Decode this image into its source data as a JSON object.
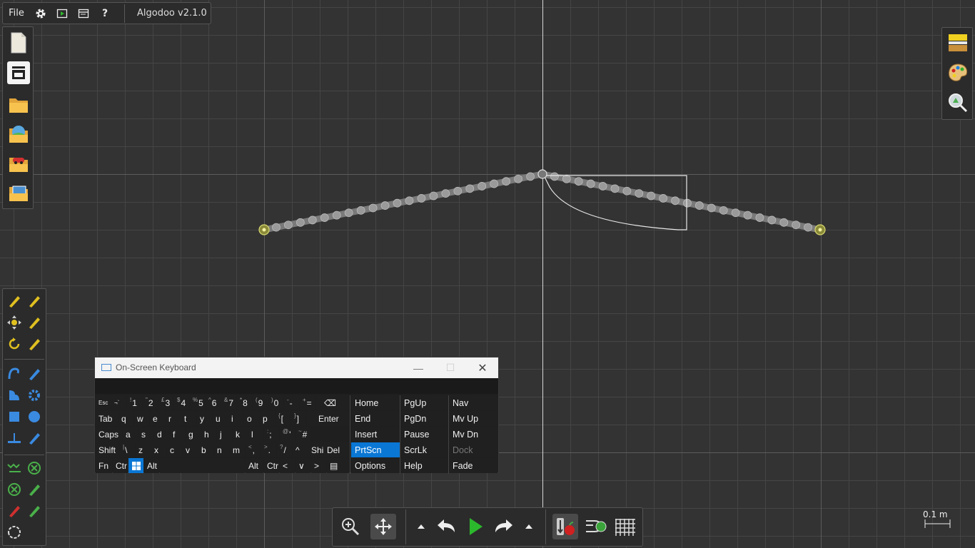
{
  "app": {
    "title": "Algodoo v2.1.0",
    "menu_file": "File"
  },
  "colors": {
    "background": "#333333",
    "grid_minor": "#444444",
    "grid_major": "#5a5a5a",
    "axis": "#d8d8d8",
    "accent_green": "#2cb82c",
    "osk_selected": "#0a77d5"
  },
  "top_icons": [
    "gear-icon",
    "play-window-icon",
    "window-icon",
    "help-icon"
  ],
  "help_label": "?",
  "file_panel": [
    "new-scene-icon",
    "scene-panel-icon",
    "open-folder-icon",
    "landscape-folder-icon",
    "car-folder-icon",
    "photo-folder-icon"
  ],
  "right_panel": [
    "background-icon",
    "palette-icon",
    "zoom-search-icon"
  ],
  "scale": {
    "label": "0.1 m"
  },
  "osk": {
    "title": "On-Screen Keyboard",
    "rows": [
      [
        {
          "t": "Esc",
          "s": true
        },
        {
          "t": "¬`",
          "s": true
        },
        {
          "t": "1",
          "u": "!"
        },
        {
          "t": "2",
          "u": "\""
        },
        {
          "t": "3",
          "u": "£"
        },
        {
          "t": "4",
          "u": "$"
        },
        {
          "t": "5",
          "u": "%"
        },
        {
          "t": "6",
          "u": "^"
        },
        {
          "t": "7",
          "u": "&"
        },
        {
          "t": "8",
          "u": "*"
        },
        {
          "t": "9",
          "u": "("
        },
        {
          "t": "0",
          "u": ")"
        },
        {
          "t": "-",
          "u": "-"
        },
        {
          "t": "=",
          "u": "+"
        },
        {
          "t": "⌫"
        }
      ],
      [
        {
          "t": "Tab"
        },
        {
          "t": "q"
        },
        {
          "t": "w"
        },
        {
          "t": "e"
        },
        {
          "t": "r"
        },
        {
          "t": "t"
        },
        {
          "t": "y"
        },
        {
          "t": "u"
        },
        {
          "t": "i"
        },
        {
          "t": "o"
        },
        {
          "t": "p"
        },
        {
          "t": "[",
          "u": "{"
        },
        {
          "t": "]",
          "u": "}"
        },
        {
          "t": "Enter"
        }
      ],
      [
        {
          "t": "Caps"
        },
        {
          "t": "a"
        },
        {
          "t": "s"
        },
        {
          "t": "d"
        },
        {
          "t": "f"
        },
        {
          "t": "g"
        },
        {
          "t": "h"
        },
        {
          "t": "j"
        },
        {
          "t": "k"
        },
        {
          "t": "l"
        },
        {
          "t": ";",
          "u": ":"
        },
        {
          "t": "'",
          "u": "@"
        },
        {
          "t": "#",
          "u": "~"
        }
      ],
      [
        {
          "t": "Shift"
        },
        {
          "t": "\\",
          "u": "|"
        },
        {
          "t": "z"
        },
        {
          "t": "x"
        },
        {
          "t": "c"
        },
        {
          "t": "v"
        },
        {
          "t": "b"
        },
        {
          "t": "n"
        },
        {
          "t": "m"
        },
        {
          "t": ",",
          "u": "<"
        },
        {
          "t": ".",
          "u": ">"
        },
        {
          "t": "/",
          "u": "?"
        },
        {
          "t": "^"
        },
        {
          "t": "Shi"
        },
        {
          "t": "Del"
        }
      ],
      [
        {
          "t": "Fn"
        },
        {
          "t": "Ctr"
        },
        {
          "t": "win"
        },
        {
          "t": "Alt"
        },
        {
          "t": ""
        },
        {
          "t": "Alt"
        },
        {
          "t": "Ctr"
        },
        {
          "t": "<"
        },
        {
          "t": "∨"
        },
        {
          "t": ">"
        },
        {
          "t": "▤"
        }
      ]
    ],
    "nav": [
      [
        "Home",
        "PgUp",
        "Nav"
      ],
      [
        "End",
        "PgDn",
        "Mv Up"
      ],
      [
        "Insert",
        "Pause",
        "Mv Dn"
      ],
      [
        "PrtScn",
        "ScrLk",
        "Dock"
      ],
      [
        "Options",
        "Help",
        "Fade"
      ]
    ],
    "selected": "PrtScn",
    "disabled": "Dock"
  },
  "tools": [
    "sketch-tool-icon",
    "pencil-tool-icon",
    "move-tool-icon",
    "drag-tool-icon",
    "rotate-tool-icon",
    "scale-tool-icon",
    "rope-tool-icon",
    "knife-tool-icon",
    "polygon-tool-icon",
    "gear-tool-icon",
    "box-tool-icon",
    "circle-tool-icon",
    "plane-tool-icon",
    "brush-tool-icon",
    "spring-tool-icon",
    "fixate-tool-icon",
    "axle-tool-icon",
    "tracer-tool-icon",
    "laser-tool-icon",
    "thruster-tool-icon",
    "texture-tool-icon"
  ],
  "bottom_toolbar": [
    "zoom-icon",
    "pan-icon",
    "undo-dropdown-icon",
    "undo-icon",
    "play-icon",
    "redo-icon",
    "redo-dropdown-icon",
    "gravity-icon",
    "air-friction-icon",
    "grid-icon"
  ]
}
